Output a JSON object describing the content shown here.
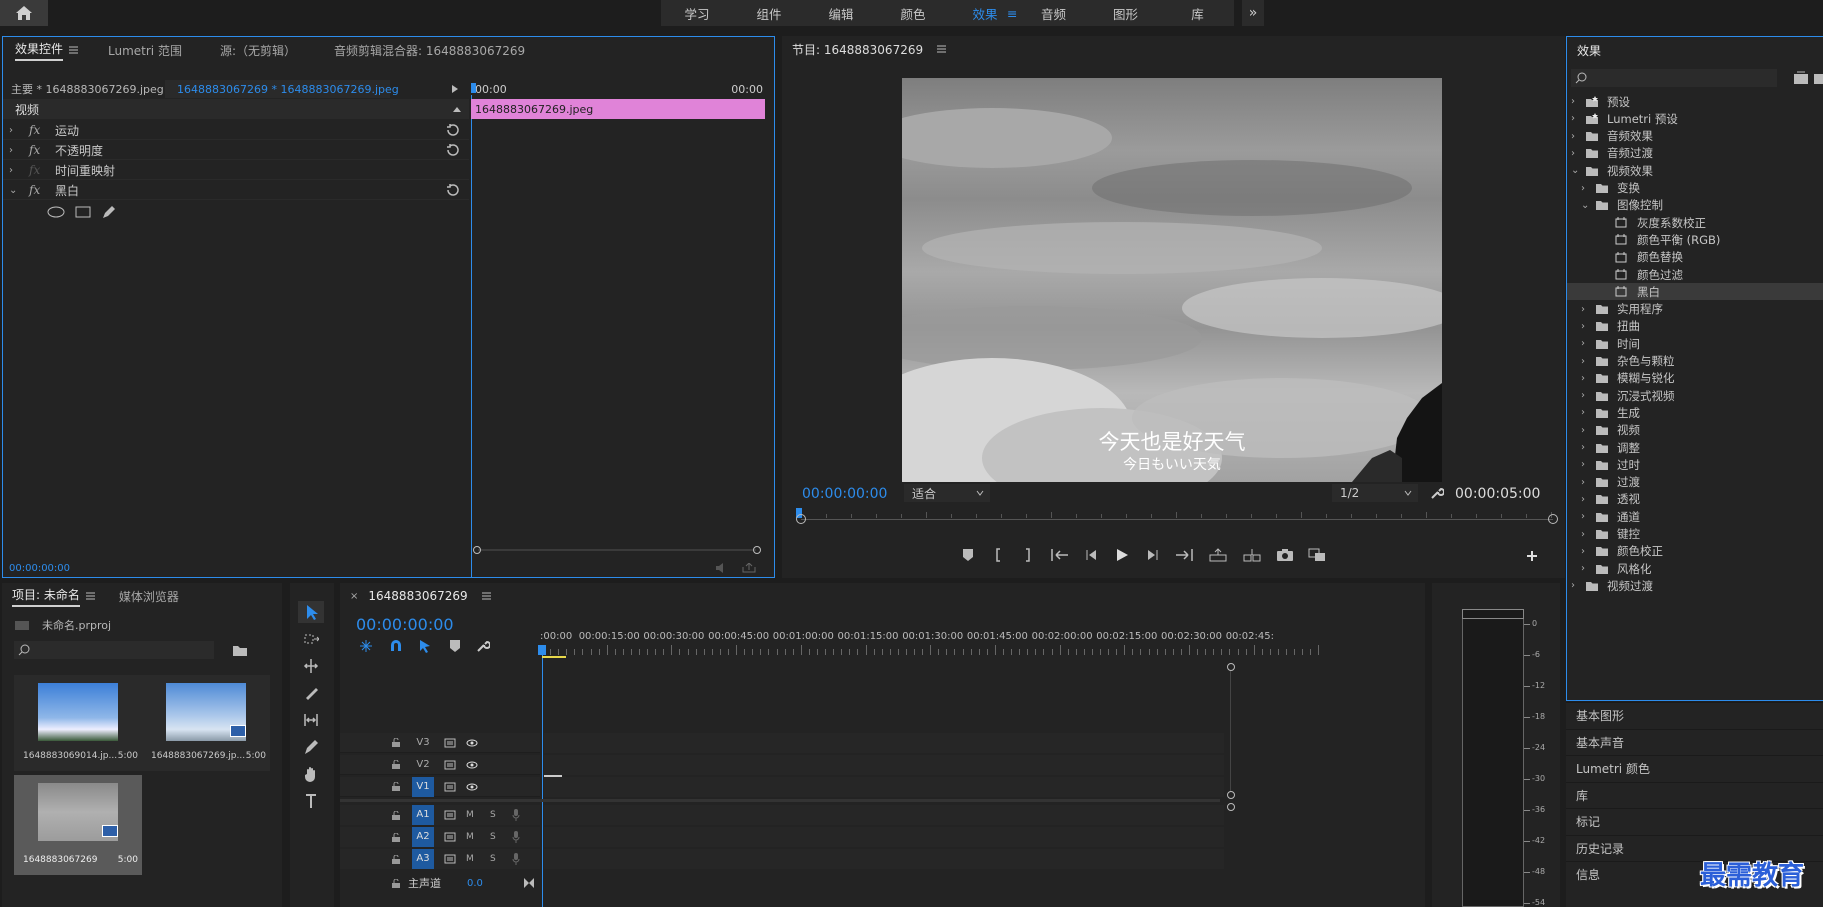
{
  "topbar": {
    "home": "home-icon",
    "workspaces": [
      "学习",
      "组件",
      "编辑",
      "颜色",
      "效果",
      "音频",
      "图形",
      "库"
    ],
    "active": "效果",
    "more": "»"
  },
  "effect_controls": {
    "tabs": [
      "效果控件",
      "Lumetri 范围",
      "源:（无剪辑）",
      "音频剪辑混合器: 1648883067269"
    ],
    "master": "主要 * 1648883067269.jpeg",
    "clip": "1648883067269 * 1648883067269.jpeg",
    "ruler_start": "00:00",
    "ruler_end": "00:00",
    "clip_label": "1648883067269.jpeg",
    "section": "视频",
    "effects": [
      {
        "name": "运动",
        "fx": "fx"
      },
      {
        "name": "不透明度",
        "fx": "fx"
      },
      {
        "name": "时间重映射",
        "fx": "fx"
      },
      {
        "name": "黑白",
        "fx": "fx"
      }
    ],
    "timecode": "00:00:00:00"
  },
  "program": {
    "title": "节目: 1648883067269",
    "subtitle_cn": "今天也是好天气",
    "subtitle_jp": "今日もいい天気",
    "timecode": "00:00:00:00",
    "fit": "适合",
    "res": "1/2",
    "duration": "00:00:05:00"
  },
  "effects_panel": {
    "title": "效果",
    "items": [
      {
        "l": "预设",
        "d": 0,
        "t": "bin"
      },
      {
        "l": "Lumetri 预设",
        "d": 0,
        "t": "bin"
      },
      {
        "l": "音频效果",
        "d": 0,
        "t": "folder"
      },
      {
        "l": "音频过渡",
        "d": 0,
        "t": "folder"
      },
      {
        "l": "视频效果",
        "d": 0,
        "t": "folder",
        "o": true
      },
      {
        "l": "变换",
        "d": 1,
        "t": "folder"
      },
      {
        "l": "图像控制",
        "d": 1,
        "t": "folder",
        "o": true
      },
      {
        "l": "灰度系数校正",
        "d": 2,
        "t": "fx"
      },
      {
        "l": "颜色平衡 (RGB)",
        "d": 2,
        "t": "fx"
      },
      {
        "l": "颜色替换",
        "d": 2,
        "t": "fx"
      },
      {
        "l": "颜色过滤",
        "d": 2,
        "t": "fx"
      },
      {
        "l": "黑白",
        "d": 2,
        "t": "fx",
        "s": true
      },
      {
        "l": "实用程序",
        "d": 1,
        "t": "folder"
      },
      {
        "l": "扭曲",
        "d": 1,
        "t": "folder"
      },
      {
        "l": "时间",
        "d": 1,
        "t": "folder"
      },
      {
        "l": "杂色与颗粒",
        "d": 1,
        "t": "folder"
      },
      {
        "l": "模糊与锐化",
        "d": 1,
        "t": "folder"
      },
      {
        "l": "沉浸式视频",
        "d": 1,
        "t": "folder"
      },
      {
        "l": "生成",
        "d": 1,
        "t": "folder"
      },
      {
        "l": "视频",
        "d": 1,
        "t": "folder"
      },
      {
        "l": "调整",
        "d": 1,
        "t": "folder"
      },
      {
        "l": "过时",
        "d": 1,
        "t": "folder"
      },
      {
        "l": "过渡",
        "d": 1,
        "t": "folder"
      },
      {
        "l": "透视",
        "d": 1,
        "t": "folder"
      },
      {
        "l": "通道",
        "d": 1,
        "t": "folder"
      },
      {
        "l": "键控",
        "d": 1,
        "t": "folder"
      },
      {
        "l": "颜色校正",
        "d": 1,
        "t": "folder"
      },
      {
        "l": "风格化",
        "d": 1,
        "t": "folder"
      },
      {
        "l": "视频过渡",
        "d": 0,
        "t": "folder"
      }
    ]
  },
  "side_panels": [
    "基本图形",
    "基本声音",
    "Lumetri 颜色",
    "库",
    "标记",
    "历史记录",
    "信息"
  ],
  "project": {
    "tabs": [
      "项目: 未命名",
      "媒体浏览器"
    ],
    "file": "未命名.prproj",
    "items": [
      {
        "name": "1648883069014.jp...",
        "dur": "5:00"
      },
      {
        "name": "1648883067269.jp...",
        "dur": "5:00"
      },
      {
        "name": "1648883067269",
        "dur": "5:00"
      }
    ]
  },
  "timeline": {
    "tab": "1648883067269",
    "timecode": "00:00:00:00",
    "ruler": [
      ":00:00",
      "00:00:15:00",
      "00:00:30:00",
      "00:00:45:00",
      "00:01:00:00",
      "00:01:15:00",
      "00:01:30:00",
      "00:01:45:00",
      "00:02:00:00",
      "00:02:15:00",
      "00:02:30:00",
      "00:02:45:"
    ],
    "video_tracks": [
      "V3",
      "V2",
      "V1"
    ],
    "audio_tracks": [
      "A1",
      "A2",
      "A3"
    ],
    "mute": "M",
    "solo": "S",
    "master": "主声道",
    "master_val": "0.0"
  },
  "meter": {
    "scale": [
      "0",
      "-6",
      "-12",
      "-18",
      "-24",
      "-30",
      "-36",
      "-42",
      "-48",
      "-54"
    ]
  },
  "watermark": "最需教育",
  "colors": {
    "accent": "#2d8ceb",
    "clip": "#e083d8",
    "bg": "#232323"
  }
}
